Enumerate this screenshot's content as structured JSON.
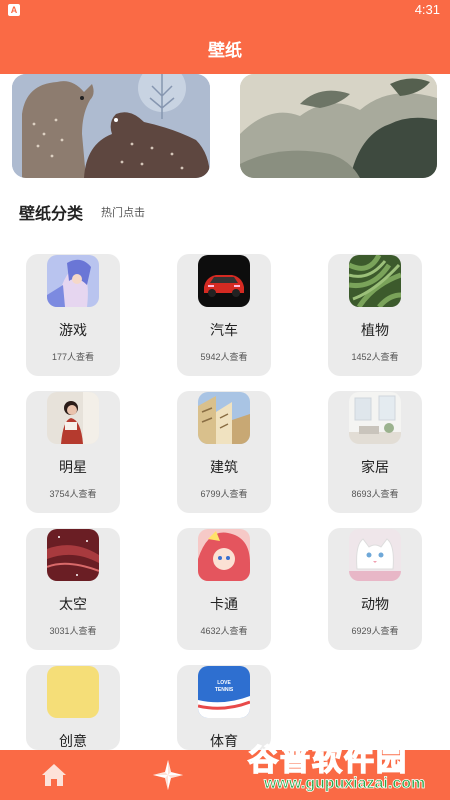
{
  "status_bar": {
    "time": "4:31",
    "left_icon": "A"
  },
  "header": {
    "title": "壁纸"
  },
  "banners": [
    {
      "name": "bears-banner"
    },
    {
      "name": "mountain-painting-banner"
    }
  ],
  "section": {
    "title": "壁纸分类",
    "subtitle": "热门点击"
  },
  "categories": [
    {
      "name": "游戏",
      "views": "177人查看"
    },
    {
      "name": "汽车",
      "views": "5942人查看"
    },
    {
      "name": "植物",
      "views": "1452人查看"
    },
    {
      "name": "明星",
      "views": "3754人查看"
    },
    {
      "name": "建筑",
      "views": "6799人查看"
    },
    {
      "name": "家居",
      "views": "8693人查看"
    },
    {
      "name": "太空",
      "views": "3031人查看"
    },
    {
      "name": "卡通",
      "views": "4632人查看"
    },
    {
      "name": "动物",
      "views": "6929人查看"
    },
    {
      "name": "创意",
      "views": ""
    },
    {
      "name": "体育",
      "views": "",
      "thumb_text_1": "LOVE",
      "thumb_text_2": "TENNIS"
    }
  ],
  "bottom_nav": [
    {
      "icon": "home-icon"
    },
    {
      "icon": "explore-icon"
    }
  ],
  "watermark": {
    "title": "谷普软件园",
    "url": "www.gupuxiazai.com"
  },
  "colors": {
    "accent": "#fa6a45",
    "card_bg": "#ebebeb",
    "watermark": "#28a84a"
  }
}
